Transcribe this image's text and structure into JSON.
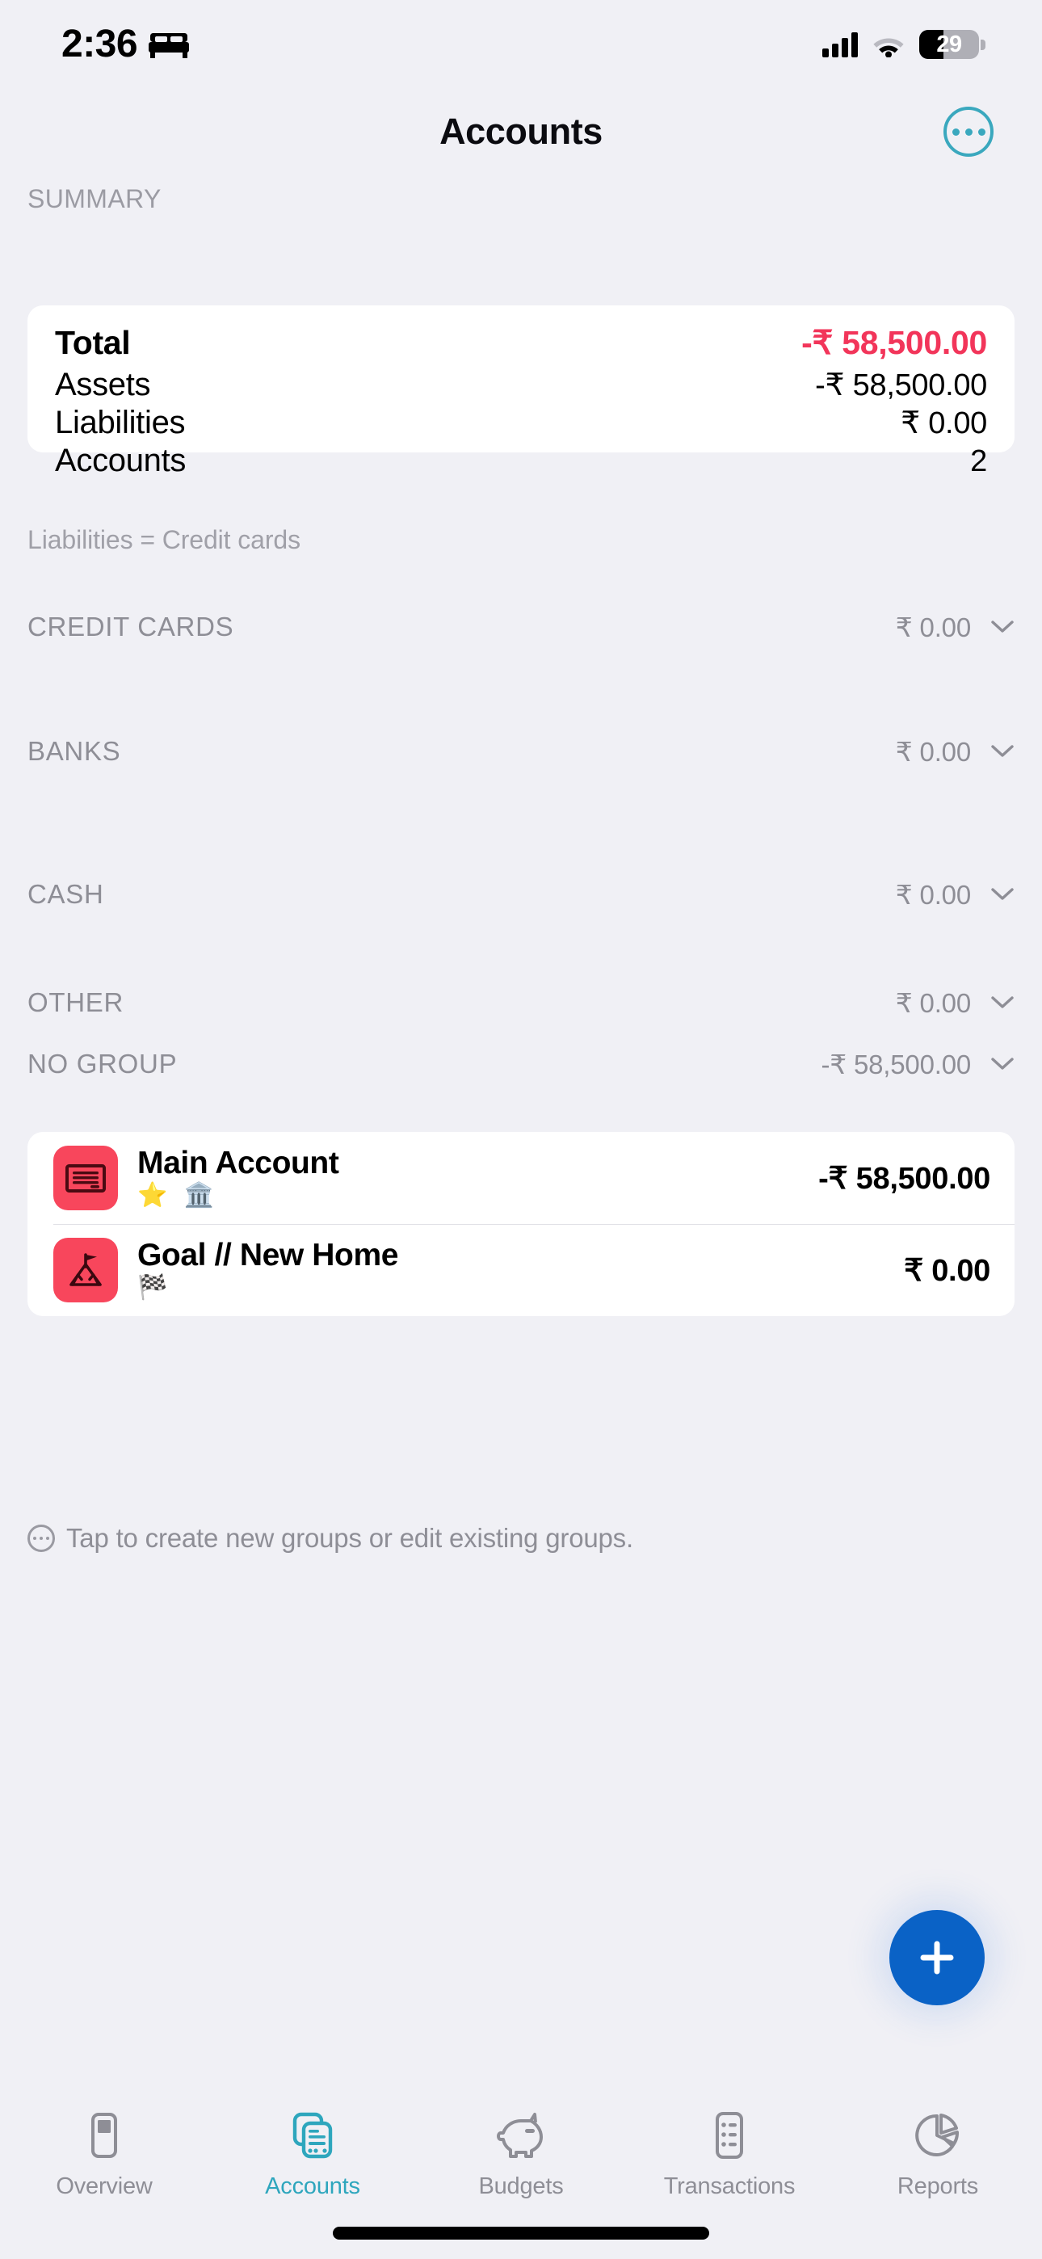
{
  "status_bar": {
    "time": "2:36",
    "focus_icon": "bed-icon",
    "cellular_icon": "cellular-signal-icon",
    "cellular_bars": 4,
    "wifi_icon": "wifi-icon",
    "battery_icon": "battery-icon",
    "battery_percent": "29"
  },
  "nav": {
    "title": "Accounts",
    "more_icon": "ellipsis-circle-icon"
  },
  "summary": {
    "section_label": "SUMMARY",
    "rows": [
      {
        "label": "Total",
        "value": "-₹ 58,500.00",
        "negative": true
      },
      {
        "label": "Assets",
        "value": "-₹ 58,500.00",
        "negative": false
      },
      {
        "label": "Liabilities",
        "value": "₹ 0.00",
        "negative": false
      },
      {
        "label": "Accounts",
        "value": "2",
        "negative": false
      }
    ],
    "note": "Liabilities = Credit cards"
  },
  "groups": [
    {
      "name": "CREDIT CARDS",
      "amount": "₹ 0.00",
      "chevron_icon": "chevron-down-icon"
    },
    {
      "name": "BANKS",
      "amount": "₹ 0.00",
      "chevron_icon": "chevron-down-icon"
    },
    {
      "name": "CASH",
      "amount": "₹ 0.00",
      "chevron_icon": "chevron-down-icon"
    },
    {
      "name": "OTHER",
      "amount": "₹ 0.00",
      "chevron_icon": "chevron-down-icon"
    },
    {
      "name": "NO GROUP",
      "amount": "-₹ 58,500.00",
      "chevron_icon": "chevron-down-icon"
    }
  ],
  "accounts": [
    {
      "name": "Main Account",
      "amount": "-₹ 58,500.00",
      "icon": "banknote-icon",
      "badges": "⭐ 🏛️"
    },
    {
      "name": "Goal // New Home",
      "amount": "₹ 0.00",
      "icon": "mountain-flag-icon",
      "badges": "🏁"
    }
  ],
  "tap_hint": {
    "icon": "ellipsis-circle-small-icon",
    "text": "Tap to create new groups or edit existing groups."
  },
  "fab": {
    "icon": "plus-icon",
    "label": "Add"
  },
  "tabbar": {
    "active": "Accounts",
    "items": [
      {
        "label": "Overview",
        "icon": "overview-card-icon"
      },
      {
        "label": "Accounts",
        "icon": "accounts-cards-icon"
      },
      {
        "label": "Budgets",
        "icon": "piggy-bank-icon"
      },
      {
        "label": "Transactions",
        "icon": "transactions-list-icon"
      },
      {
        "label": "Reports",
        "icon": "pie-chart-icon"
      }
    ]
  },
  "colors": {
    "background": "#F0F0F5",
    "card": "#FFFFFF",
    "accent_teal": "#3AA8BE",
    "negative_red": "#F2355A",
    "account_tile": "#F8465C",
    "fab_blue": "#0A62C6",
    "muted_text": "#8E8E96"
  }
}
